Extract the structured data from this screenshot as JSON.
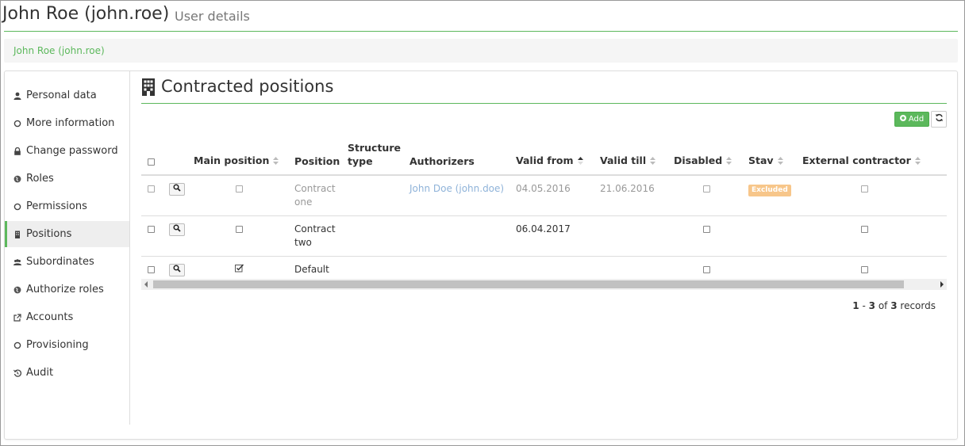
{
  "header": {
    "title": "John Roe (john.roe)",
    "subtitle": "User details"
  },
  "breadcrumb": {
    "item": "John Roe (john.roe)"
  },
  "sidebar": {
    "items": [
      {
        "label": "Personal data",
        "icon": "user-icon"
      },
      {
        "label": "More information",
        "icon": "circle-icon"
      },
      {
        "label": "Change password",
        "icon": "lock-icon"
      },
      {
        "label": "Roles",
        "icon": "globe-icon"
      },
      {
        "label": "Permissions",
        "icon": "circle-icon"
      },
      {
        "label": "Positions",
        "icon": "building-icon",
        "active": true
      },
      {
        "label": "Subordinates",
        "icon": "users-icon"
      },
      {
        "label": "Authorize roles",
        "icon": "globe-icon"
      },
      {
        "label": "Accounts",
        "icon": "external-link-icon"
      },
      {
        "label": "Provisioning",
        "icon": "circle-icon"
      },
      {
        "label": "Audit",
        "icon": "history-icon"
      }
    ]
  },
  "content": {
    "title": "Contracted positions",
    "add_label": "Add",
    "table": {
      "columns": {
        "main_position": "Main position",
        "position": "Position",
        "structure_type": "Structure type",
        "authorizers": "Authorizers",
        "valid_from": "Valid from",
        "valid_till": "Valid till",
        "disabled": "Disabled",
        "stav": "Stav",
        "external_contractor": "External contractor"
      },
      "rows": [
        {
          "main": false,
          "position": "Contract one",
          "structure_type": "",
          "authorizers": "John Doe (john.doe)",
          "valid_from": "04.05.2016",
          "valid_till": "21.06.2016",
          "disabled": false,
          "stav": "Excluded",
          "external": false,
          "id": "ed2"
        },
        {
          "main": false,
          "position": "Contract two",
          "structure_type": "",
          "authorizers": "",
          "valid_from": "06.04.2017",
          "valid_till": "",
          "disabled": false,
          "stav": "",
          "external": false,
          "id": "78e"
        },
        {
          "main": true,
          "position": "Default",
          "structure_type": "",
          "authorizers": "",
          "valid_from": "",
          "valid_till": "",
          "disabled": false,
          "stav": "",
          "external": false,
          "id": "bf6"
        }
      ]
    },
    "pager": {
      "from": "1",
      "to": "3",
      "of_label": "of",
      "total": "3",
      "records_label": "records"
    }
  },
  "colors": {
    "accent": "#5cb85c",
    "link": "#337ab7",
    "excluded": "#f7c68a"
  }
}
